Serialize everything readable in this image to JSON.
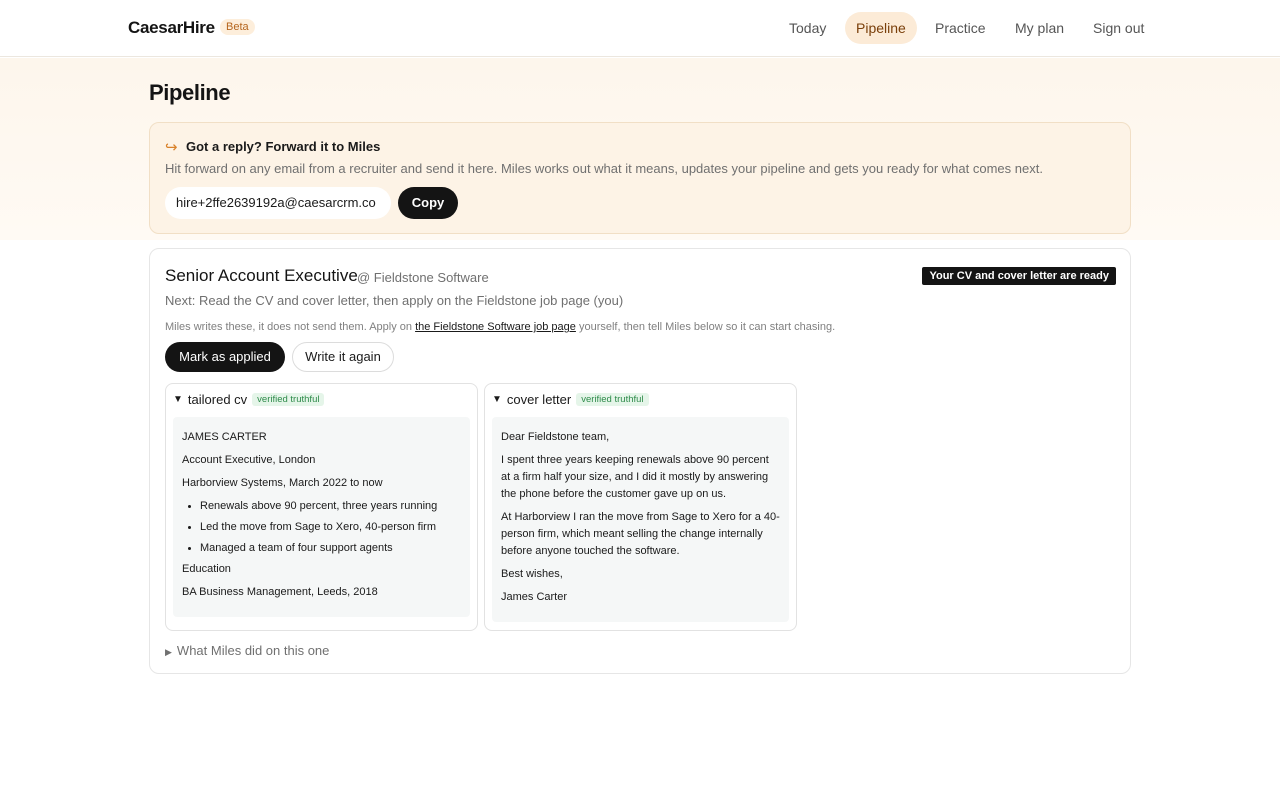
{
  "brand": {
    "name": "CaesarHire",
    "badge": "Beta"
  },
  "nav": {
    "items": [
      {
        "label": "Today",
        "active": false
      },
      {
        "label": "Pipeline",
        "active": true
      },
      {
        "label": "Practice",
        "active": false
      },
      {
        "label": "My plan",
        "active": false
      },
      {
        "label": "Sign out",
        "active": false
      }
    ]
  },
  "page": {
    "title": "Pipeline"
  },
  "forward": {
    "title": "Got a reply? Forward it to Miles",
    "description": "Hit forward on any email from a recruiter and send it here. Miles works out what it means, updates your pipeline and gets you ready for what comes next.",
    "email": "hire+2ffe2639192a@caesarcrm.co",
    "copy_label": "Copy"
  },
  "job": {
    "title": "Senior Account Executive",
    "company": "@ Fieldstone Software",
    "badge": "Your CV and cover letter are ready",
    "next": "Next: Read the CV and cover letter, then apply on the Fieldstone job page (you)",
    "note_before": "Miles writes these, it does not send them. Apply on ",
    "note_link": "the Fieldstone Software job page",
    "note_after": " yourself, then tell Miles below so it can start chasing.",
    "mark_applied_label": "Mark as applied",
    "rewrite_label": "Write it again",
    "what_miles_label": "What Miles did on this one"
  },
  "cv": {
    "label": "tailored cv",
    "verified": "verified truthful",
    "name": "JAMES CARTER",
    "role": "Account Executive, London",
    "employer": "Harborview Systems, March 2022 to now",
    "bullets": [
      "Renewals above 90 percent, three years running",
      "Led the move from Sage to Xero, 40-person firm",
      "Managed a team of four support agents"
    ],
    "education_heading": "Education",
    "education": "BA Business Management, Leeds, 2018"
  },
  "letter": {
    "label": "cover letter",
    "verified": "verified truthful",
    "greeting": "Dear Fieldstone team,",
    "para1": "I spent three years keeping renewals above 90 percent at a firm half your size, and I did it mostly by answering the phone before the customer gave up on us.",
    "para2": "At Harborview I ran the move from Sage to Xero for a 40-person firm, which meant selling the change internally before anyone touched the software.",
    "signoff": "Best wishes,",
    "signature": "James Carter"
  }
}
